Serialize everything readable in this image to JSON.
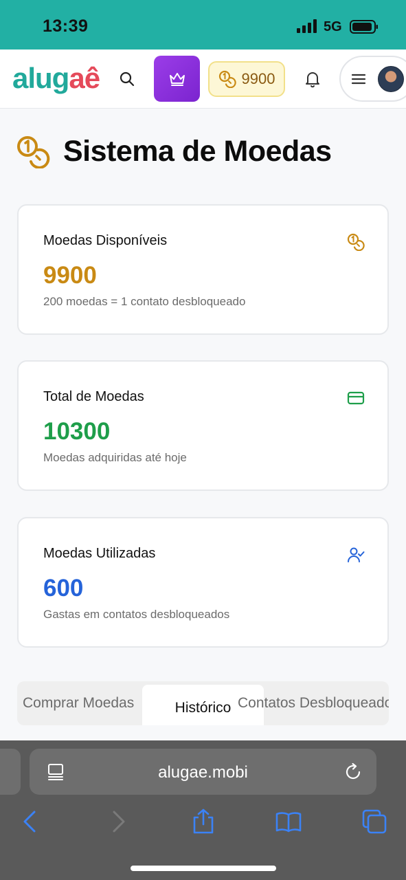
{
  "status_bar": {
    "time": "13:39",
    "network": "5G"
  },
  "header": {
    "logo": {
      "main": "alug",
      "accent": "aê"
    },
    "coins_balance": "9900"
  },
  "page": {
    "title": "Sistema de Moedas"
  },
  "cards": [
    {
      "label": "Moedas Disponíveis",
      "value": "9900",
      "subtitle": "200 moedas = 1 contato desbloqueado",
      "color": "#c98a14",
      "icon": "coins-icon"
    },
    {
      "label": "Total de Moedas",
      "value": "10300",
      "subtitle": "Moedas adquiridas até hoje",
      "color": "#1e9e4a",
      "icon": "credit-card-icon"
    },
    {
      "label": "Moedas Utilizadas",
      "value": "600",
      "subtitle": "Gastas em contatos desbloqueados",
      "color": "#2563d9",
      "icon": "user-check-icon"
    }
  ],
  "tabs": [
    {
      "label": "Comprar Moedas",
      "active": false
    },
    {
      "label": "Histórico",
      "active": true
    },
    {
      "label": "Contatos Desbloqueados",
      "active": false
    }
  ],
  "browser": {
    "url": "alugae.mobi"
  },
  "colors": {
    "brand_teal": "#21a99b",
    "brand_red": "#e54a5a",
    "premium_purple": "#8a2fdc",
    "ios_blue": "#3b82f6"
  }
}
